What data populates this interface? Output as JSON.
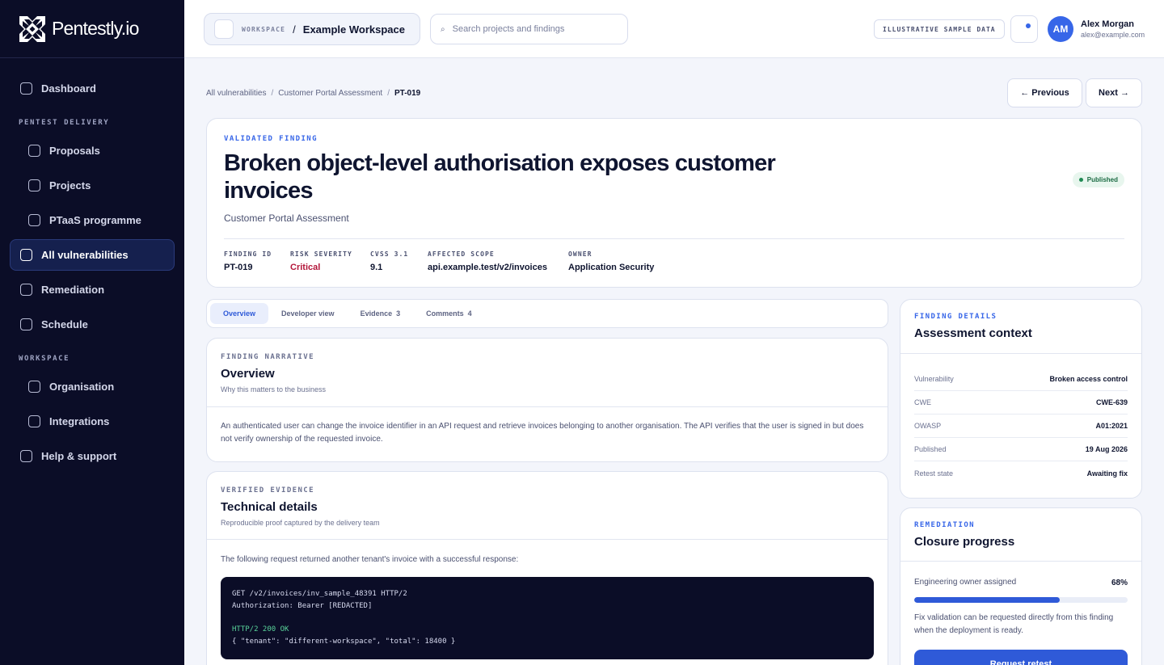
{
  "brand": {
    "name": "Pentestly.io"
  },
  "sidebar": {
    "items": [
      {
        "label": "Dashboard"
      },
      {
        "label": "Proposals"
      },
      {
        "label": "Projects"
      },
      {
        "label": "PTaaS programme"
      },
      {
        "label": "All vulnerabilities",
        "active": true
      },
      {
        "label": "Remediation"
      },
      {
        "label": "Schedule"
      },
      {
        "label": "Organisation"
      },
      {
        "label": "Integrations"
      },
      {
        "label": "Help & support"
      }
    ],
    "sections": [
      "PENTEST DELIVERY",
      "WORKSPACE"
    ]
  },
  "topbar": {
    "workspace_label": "WORKSPACE",
    "workspace_sep": "/",
    "workspace_name": "Example Workspace",
    "search_placeholder": "Search projects and findings",
    "sample_badge": "ILLUSTRATIVE SAMPLE DATA",
    "user": {
      "initials": "AM",
      "name": "Alex Morgan",
      "email": "alex@example.com"
    }
  },
  "breadcrumb": {
    "items": [
      "All vulnerabilities",
      "Customer Portal Assessment",
      "PT-019"
    ],
    "sep": "/"
  },
  "pager": {
    "previous": "← Previous",
    "next": "Next →"
  },
  "finding": {
    "eyebrow": "VALIDATED FINDING",
    "title": "Broken object-level authorisation exposes customer invoices",
    "subtitle": "Customer Portal Assessment",
    "status": "Published",
    "meta": [
      {
        "label": "FINDING ID",
        "value": "PT-019"
      },
      {
        "label": "RISK SEVERITY",
        "value": "Critical"
      },
      {
        "label": "CVSS 3.1",
        "value": "9.1"
      },
      {
        "label": "AFFECTED SCOPE",
        "value": "api.example.test/v2/invoices"
      },
      {
        "label": "OWNER",
        "value": "Application Security"
      }
    ]
  },
  "tabs": [
    {
      "label": "Overview",
      "count": ""
    },
    {
      "label": "Developer view",
      "count": ""
    },
    {
      "label": "Evidence",
      "count": "3"
    },
    {
      "label": "Comments",
      "count": "4"
    }
  ],
  "overview": {
    "eyebrow": "FINDING NARRATIVE",
    "title": "Overview",
    "caption": "Why this matters to the business",
    "body": "An authenticated user can change the invoice identifier in an API request and retrieve invoices belonging to another organisation. The API verifies that the user is signed in but does not verify ownership of the requested invoice."
  },
  "evidence": {
    "eyebrow": "VERIFIED EVIDENCE",
    "title": "Technical details",
    "caption": "Reproducible proof captured by the delivery team",
    "body": "The following request returned another tenant's invoice with a successful response:",
    "code": {
      "line1": "GET /v2/invoices/inv_sample_48391 HTTP/2",
      "line2": "Authorization: Bearer [REDACTED]",
      "line3": "HTTP/2 200 OK",
      "line4": "{ \"tenant\": \"different-workspace\", \"total\": 18400 }"
    }
  },
  "context": {
    "eyebrow": "FINDING DETAILS",
    "title": "Assessment context",
    "rows": [
      {
        "key": "Vulnerability",
        "value": "Broken access control"
      },
      {
        "key": "CWE",
        "value": "CWE-639"
      },
      {
        "key": "OWASP",
        "value": "A01:2021"
      },
      {
        "key": "Published",
        "value": "19 Aug 2026"
      },
      {
        "key": "Retest state",
        "value": "Awaiting fix"
      }
    ]
  },
  "closure": {
    "eyebrow": "REMEDIATION",
    "title": "Closure progress",
    "progress_label": "Engineering owner assigned",
    "progress_text": "68%",
    "progress_fraction": 0.68,
    "note": "Fix validation can be requested directly from this finding when the deployment is ready.",
    "button": "Request retest"
  },
  "colors": {
    "accent": "#2f5ad8",
    "sidebar_bg": "#0b0d27",
    "critical": "#b3163a",
    "success": "#1f8a53"
  }
}
